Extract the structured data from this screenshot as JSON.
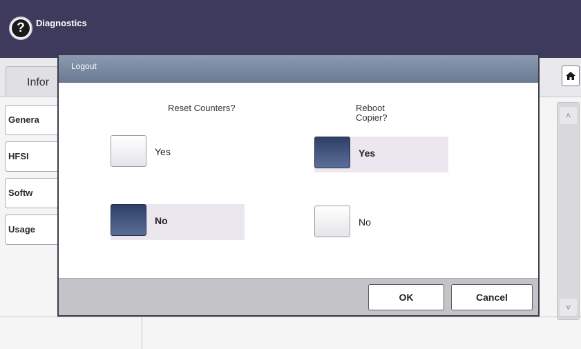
{
  "header": {
    "title": "Diagnostics",
    "help_icon": "?"
  },
  "background": {
    "tab_label": "Infor",
    "side_buttons": [
      "Genera",
      "HFSI",
      "Softw",
      "Usage"
    ],
    "scroll_up": "˄",
    "scroll_down": "˅"
  },
  "dialog": {
    "title": "Logout",
    "reset_group": {
      "label": "Reset Counters?",
      "yes_label": "Yes",
      "no_label": "No",
      "selected": "No"
    },
    "reboot_group": {
      "label": "Reboot Copier?",
      "yes_label": "Yes",
      "no_label": "No",
      "selected": "Yes"
    },
    "ok_label": "OK",
    "cancel_label": "Cancel"
  },
  "colors": {
    "header_bg": "#3d3a5c",
    "selected_radio": "#2f3f66",
    "dialog_title_bg": "#7a8aa4"
  }
}
